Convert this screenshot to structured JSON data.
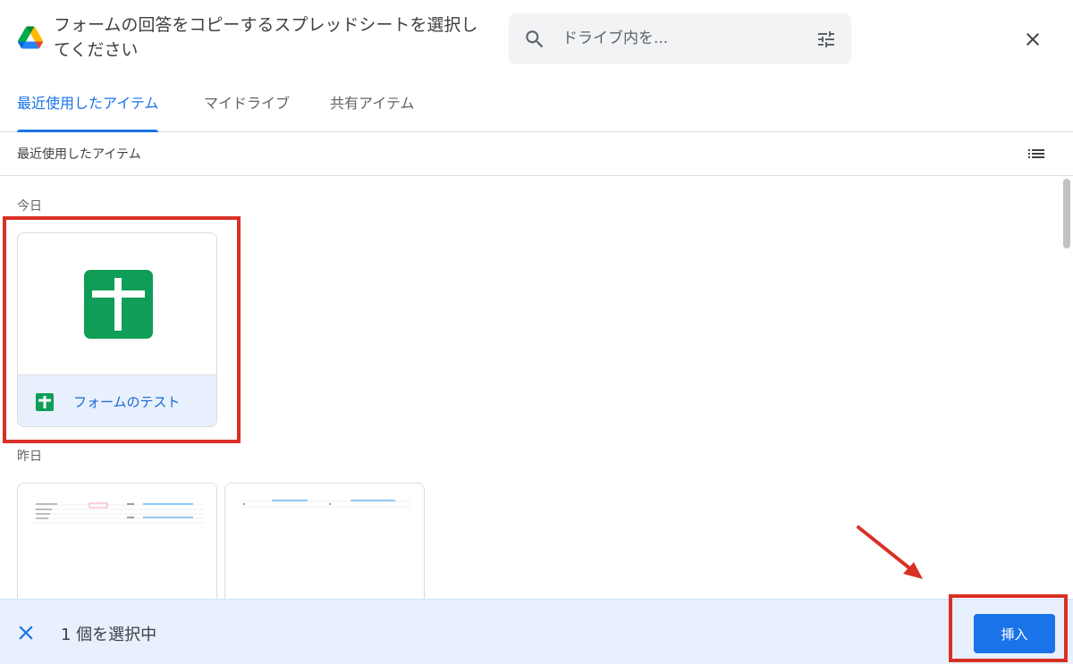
{
  "dialog": {
    "title": "フォームの回答をコピーするスプレッドシートを選択してください"
  },
  "search": {
    "placeholder": "ドライブ内を..."
  },
  "tabs": [
    {
      "label": "最近使用したアイテム",
      "active": true
    },
    {
      "label": "マイドライブ",
      "active": false
    },
    {
      "label": "共有アイテム",
      "active": false
    }
  ],
  "subheader": {
    "title": "最近使用したアイテム"
  },
  "sections": {
    "today_label": "今日",
    "yesterday_label": "昨日"
  },
  "files": {
    "today": [
      {
        "name": "フォームのテスト",
        "type": "spreadsheet",
        "selected": true
      }
    ]
  },
  "bottom_bar": {
    "selection_text": "1 個を選択中",
    "insert_label": "挿入"
  },
  "colors": {
    "accent": "#1a73e8",
    "sheets_green": "#0f9d58",
    "highlight_red": "#d93025",
    "selected_bg": "#e8f0fe"
  },
  "icons": {
    "logo": "google-drive-logo",
    "search": "search-icon",
    "filter": "tune-icon",
    "close": "close-icon",
    "list_view": "list-view-icon",
    "file_type": "google-sheets-icon",
    "deselect": "close-icon"
  }
}
